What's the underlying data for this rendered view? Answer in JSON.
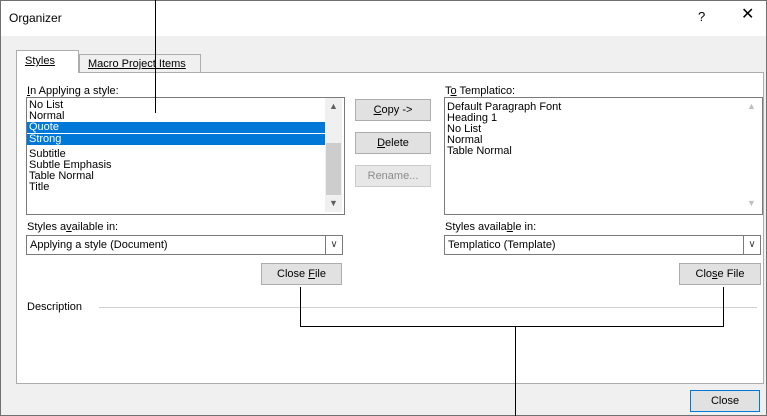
{
  "dialog": {
    "title": "Organizer",
    "help_glyph": "?",
    "close_glyph": "✕"
  },
  "tabs": [
    {
      "label": "Styles",
      "active": true
    },
    {
      "label": "Macro Project Items",
      "active": false
    }
  ],
  "left": {
    "list_label_ul": "I",
    "list_label_rest": "n Applying a style:",
    "items": [
      "No List",
      "Normal",
      "Quote",
      "Strong",
      "Subtitle",
      "Subtle Emphasis",
      "Table Normal",
      "Title"
    ],
    "selected": [
      "Quote",
      "Strong"
    ],
    "available_label_pre": "Styles a",
    "available_label_ul": "v",
    "available_label_post": "ailable in:",
    "available_value": "Applying a style (Document)",
    "close_file_pre": "Close ",
    "close_file_ul": "F",
    "close_file_post": "ile"
  },
  "middle": {
    "copy_ul": "C",
    "copy_rest": "opy ->",
    "delete_ul": "D",
    "delete_rest": "elete",
    "rename_label": "Rename..."
  },
  "right": {
    "list_label_pre": "T",
    "list_label_ul": "o",
    "list_label_post": " Templatico:",
    "items": [
      "Default Paragraph Font",
      "Heading 1",
      "No List",
      "Normal",
      "Table Normal"
    ],
    "available_label_pre": "Styles availa",
    "available_label_ul": "b",
    "available_label_post": "le in:",
    "available_value": "Templatico (Template)",
    "close_file_pre": "Clo",
    "close_file_ul": "s",
    "close_file_post": "e File"
  },
  "description": {
    "label": "Description"
  },
  "footer": {
    "close_label": "Close"
  },
  "icons": {
    "scroll_up": "▲",
    "scroll_down": "▼",
    "dropdown": "∨"
  }
}
